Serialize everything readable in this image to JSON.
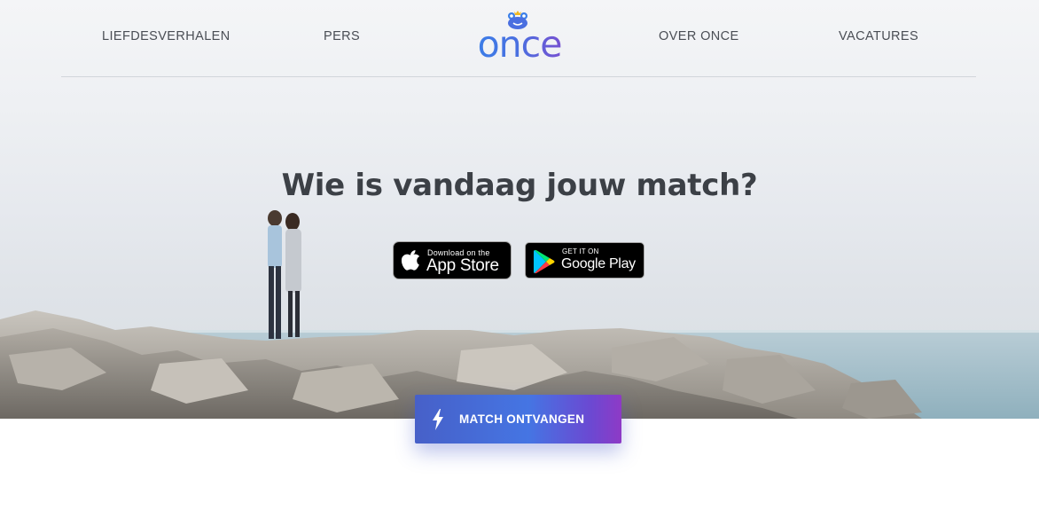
{
  "nav": {
    "links": [
      "LIEFDESVERHALEN",
      "PERS",
      "OVER ONCE",
      "VACATURES"
    ],
    "logo_text": "once"
  },
  "hero": {
    "headline": "Wie is vandaag jouw match?"
  },
  "badges": {
    "apple_small": "Download on the",
    "apple_big": "App Store",
    "google_small": "GET IT ON",
    "google_big": "Google Play"
  },
  "cta": {
    "label": "MATCH ONTVANGEN",
    "icon": "lightning-icon"
  },
  "colors": {
    "brand_blue": "#3a7ee8",
    "brand_purple": "#7a4ed0",
    "cta_start": "#4760c8",
    "cta_end": "#8e3ac6"
  }
}
